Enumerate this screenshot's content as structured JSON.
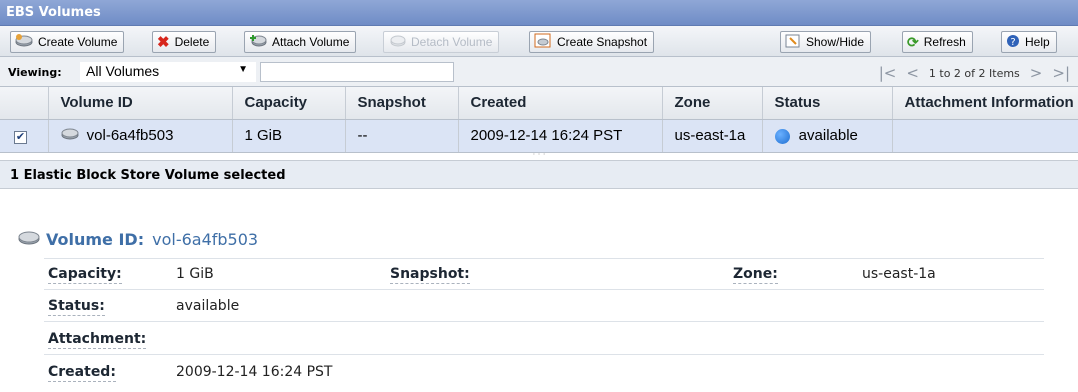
{
  "window": {
    "title": "EBS Volumes"
  },
  "toolbar": {
    "create_volume": "Create Volume",
    "delete": "Delete",
    "attach_volume": "Attach Volume",
    "detach_volume": "Detach Volume",
    "create_snapshot": "Create Snapshot",
    "show_hide": "Show/Hide",
    "refresh": "Refresh",
    "help": "Help"
  },
  "viewbar": {
    "label": "Viewing:",
    "selected": "All Volumes",
    "filter_value": "",
    "pager_text": "1 to 2 of 2 Items"
  },
  "table": {
    "columns": [
      "Volume ID",
      "Capacity",
      "Snapshot",
      "Created",
      "Zone",
      "Status",
      "Attachment Information"
    ],
    "rows": [
      {
        "checked": true,
        "volume_id": "vol-6a4fb503",
        "capacity": "1 GiB",
        "snapshot": "--",
        "created": "2009-12-14 16:24 PST",
        "zone": "us-east-1a",
        "status": "available",
        "attachment": ""
      }
    ]
  },
  "details": {
    "header": "1 Elastic Block Store Volume selected",
    "volume_id_label": "Volume ID:",
    "volume_id": "vol-6a4fb503",
    "capacity_label": "Capacity:",
    "capacity": "1 GiB",
    "snapshot_label": "Snapshot:",
    "snapshot": "",
    "zone_label": "Zone:",
    "zone": "us-east-1a",
    "status_label": "Status:",
    "status": "available",
    "attachment_label": "Attachment:",
    "attachment": "",
    "created_label": "Created:",
    "created": "2009-12-14 16:24 PST"
  },
  "colors": {
    "title_bar": "#6f8cc6",
    "selected_row": "#dbe4f5",
    "status_available": "#1f6fd1",
    "link_blue": "#3f6fa7"
  }
}
